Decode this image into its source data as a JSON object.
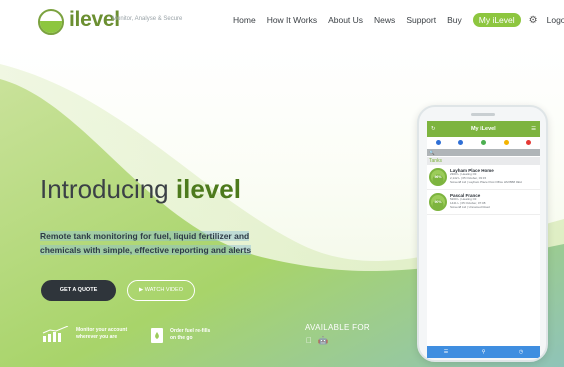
{
  "nav": {
    "brand": "ilevel",
    "tagline": "Monitor, Analyse & Secure",
    "items": [
      "Home",
      "How It Works",
      "About Us",
      "News",
      "Support",
      "Buy"
    ],
    "highlight": "My iLevel",
    "logout": "Logout",
    "settings_icon": "settings-gear-icon"
  },
  "hero": {
    "headline_prefix": "Introducing",
    "headline_brand": "ilevel",
    "subheading": "Remote tank monitoring for fuel, liquid fertilizer and chemicals with simple, effective reporting and alerts",
    "quote_button": "GET A QUOTE",
    "video_button": "▶  WATCH VIDEO",
    "features": [
      {
        "line1": "Monitor your account",
        "line2": "wherever you are",
        "icon": "bar-chart-icon"
      },
      {
        "line1": "Order fuel re-fills",
        "line2": "on the go",
        "icon": "fuel-can-icon"
      }
    ],
    "available_for": "AVAILABLE FOR",
    "store_icons": [
      "apple-icon",
      "android-icon"
    ]
  },
  "phone": {
    "title": "My iLevel",
    "search_placeholder": "🔍",
    "tanks_heading": "Tanks",
    "status_colors": [
      "#2f6fd6",
      "#2f6fd6",
      "#4caf50",
      "#f4b400",
      "#e53935"
    ],
    "tanks": [
      {
        "name": "Layham Place Home",
        "level": "96%",
        "lines": [
          "2300 L | Heating Oil",
          "2,142 L | 05 October, 03:15",
          "Screen8 Ltd | Layham Place Post Office HM BB8 0EH"
        ]
      },
      {
        "name": "Pascal France",
        "level": "90%",
        "lines": [
          "5200 L | Heating Oil",
          "1441 L | 05 October, 07:08",
          "Screen8 Ltd | Unnamed Road"
        ]
      }
    ],
    "tab_icons": [
      "list-icon",
      "location-pin-icon",
      "clock-icon"
    ]
  },
  "colors": {
    "brand_green": "#8dc63f",
    "dark_button": "#2f353b",
    "app_blue": "#3f8ee0"
  }
}
